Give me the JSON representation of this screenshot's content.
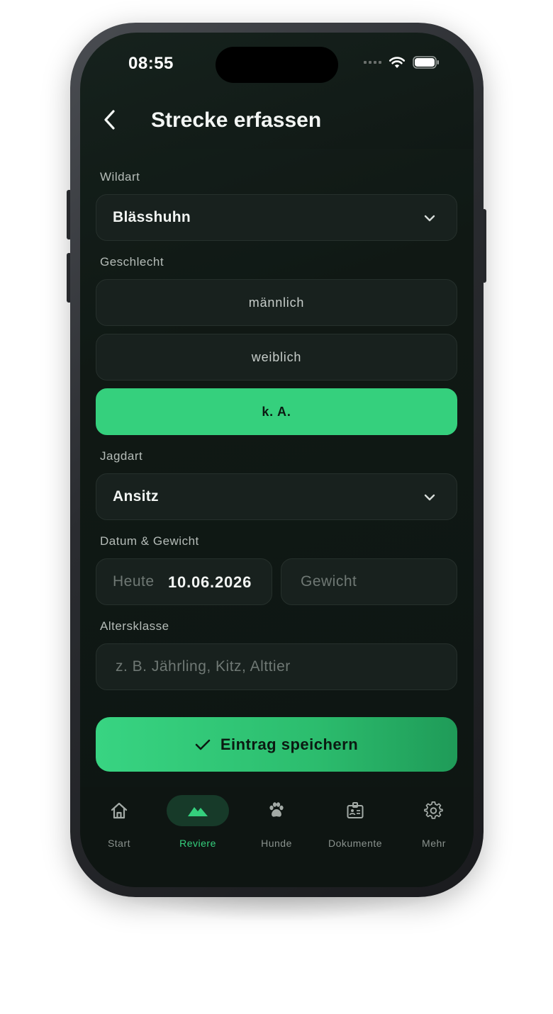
{
  "status": {
    "time": "08:55"
  },
  "header": {
    "title": "Strecke erfassen"
  },
  "form": {
    "wildart": {
      "label": "Wildart",
      "value": "Blässhuhn"
    },
    "geschlecht": {
      "label": "Geschlecht",
      "options": [
        "männlich",
        "weiblich",
        "k. A."
      ],
      "selected": "k. A."
    },
    "jagdart": {
      "label": "Jagdart",
      "value": "Ansitz"
    },
    "datum_gewicht": {
      "label": "Datum & Gewicht",
      "date_prefix": "Heute",
      "date": "10.06.2026",
      "weight_placeholder": "Gewicht"
    },
    "altersklasse": {
      "label": "Altersklasse",
      "placeholder": "z. B. Jährling, Kitz, Alttier"
    },
    "save_label": "Eintrag speichern"
  },
  "tabbar": {
    "items": [
      {
        "label": "Start",
        "icon": "home-icon"
      },
      {
        "label": "Reviere",
        "icon": "mountain-icon",
        "active": true
      },
      {
        "label": "Hunde",
        "icon": "paw-icon"
      },
      {
        "label": "Dokumente",
        "icon": "id-card-icon"
      },
      {
        "label": "Mehr",
        "icon": "gear-icon"
      }
    ]
  },
  "colors": {
    "accent": "#35d07d",
    "background": "#0b110f",
    "field": "#18211e"
  }
}
